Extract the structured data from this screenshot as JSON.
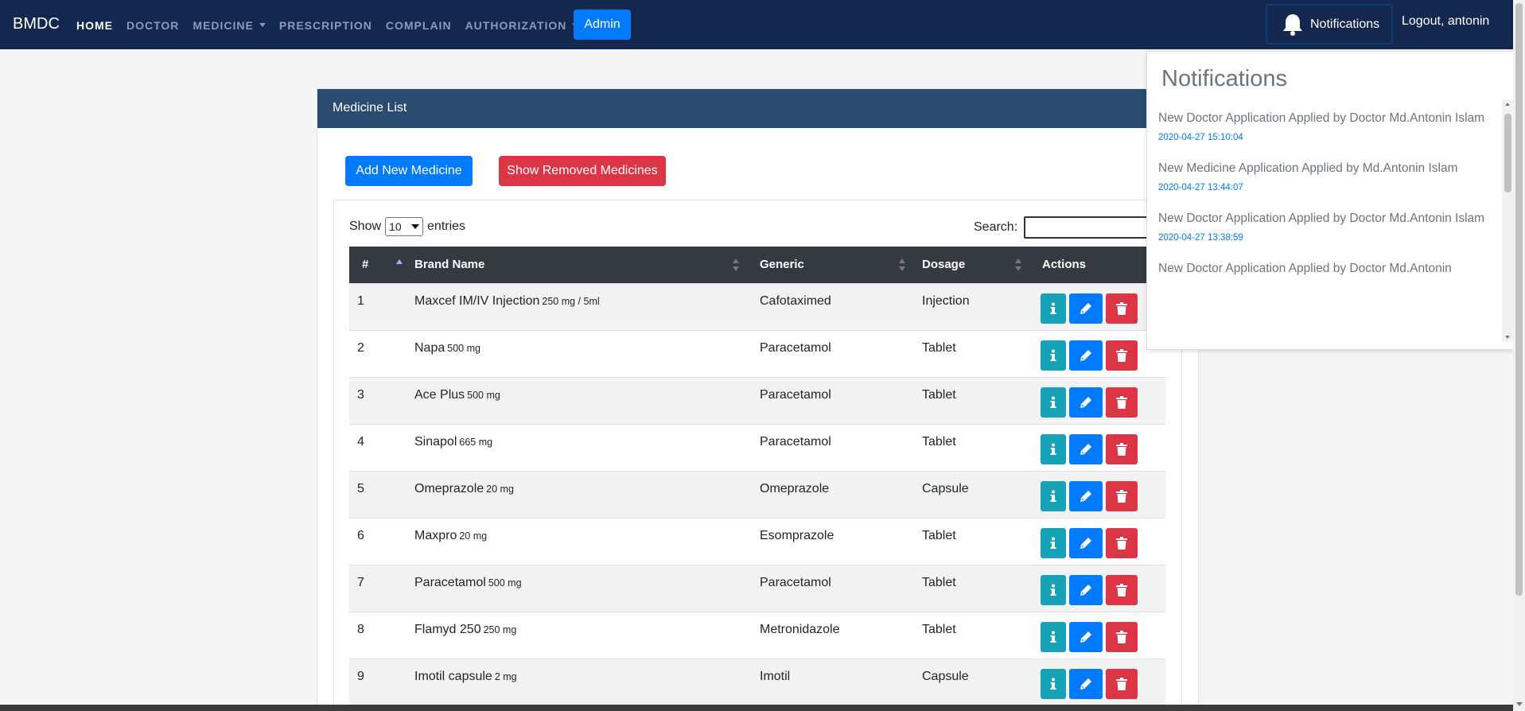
{
  "navbar": {
    "brand": "BMDC",
    "links": [
      "HOME",
      "DOCTOR",
      "MEDICINE",
      "PRESCRIPTION",
      "COMPLAIN",
      "AUTHORIZATION"
    ],
    "admin_label": "Admin",
    "notifications_label": "Notifications",
    "logout_label": "Logout, antonin"
  },
  "card": {
    "header": "Medicine List",
    "add_label": "Add New Medicine",
    "removed_label": "Show Removed Medicines"
  },
  "controls": {
    "show_label": "Show",
    "entries_value": "10",
    "entries_label": "entries",
    "search_label": "Search:"
  },
  "table": {
    "headers": [
      "#",
      "Brand Name",
      "Generic",
      "Dosage",
      "Actions"
    ],
    "rows": [
      {
        "no": "1",
        "brand": "Maxcef IM/IV Injection",
        "strength": "250 mg / 5ml",
        "generic": "Cafotaximed",
        "dosage": "Injection"
      },
      {
        "no": "2",
        "brand": "Napa",
        "strength": "500 mg",
        "generic": "Paracetamol",
        "dosage": "Tablet"
      },
      {
        "no": "3",
        "brand": "Ace Plus",
        "strength": "500 mg",
        "generic": "Paracetamol",
        "dosage": "Tablet"
      },
      {
        "no": "4",
        "brand": "Sinapol",
        "strength": "665 mg",
        "generic": "Paracetamol",
        "dosage": "Tablet"
      },
      {
        "no": "5",
        "brand": "Omeprazole",
        "strength": "20 mg",
        "generic": "Omeprazole",
        "dosage": "Capsule"
      },
      {
        "no": "6",
        "brand": "Maxpro",
        "strength": "20 mg",
        "generic": "Esomprazole",
        "dosage": "Tablet"
      },
      {
        "no": "7",
        "brand": "Paracetamol",
        "strength": "500 mg",
        "generic": "Paracetamol",
        "dosage": "Tablet"
      },
      {
        "no": "8",
        "brand": "Flamyd 250",
        "strength": "250 mg",
        "generic": "Metronidazole",
        "dosage": "Tablet"
      },
      {
        "no": "9",
        "brand": "Imotil capsule",
        "strength": "2 mg",
        "generic": "Imotil",
        "dosage": "Capsule"
      }
    ]
  },
  "notifications": {
    "title": "Notifications",
    "items": [
      {
        "text": "New Doctor Application Applied by Doctor Md.Antonin Islam",
        "time": "2020-04-27 15:10:04"
      },
      {
        "text": "New Medicine Application Applied by Md.Antonin Islam",
        "time": "2020-04-27 13:44:07"
      },
      {
        "text": "New Doctor Application Applied by Doctor Md.Antonin Islam",
        "time": "2020-04-27 13:38:59"
      },
      {
        "text": "New Doctor Application Applied by Doctor Md.Antonin",
        "time": ""
      }
    ]
  },
  "colors": {
    "navbar": "#14274e",
    "primary": "#007bff",
    "danger": "#dc3545",
    "info": "#17a2b8",
    "card_header": "#2a4a6f"
  }
}
